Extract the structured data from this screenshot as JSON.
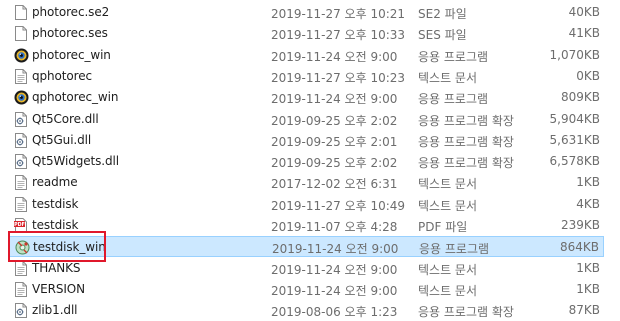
{
  "files": [
    {
      "name": "photorec.se2",
      "date": "2019-11-27 오후 10:21",
      "type": "SE2 파일",
      "size": "40KB",
      "icon": "file-icon"
    },
    {
      "name": "photorec.ses",
      "date": "2019-11-27 오후 10:33",
      "type": "SES 파일",
      "size": "41KB",
      "icon": "file-icon"
    },
    {
      "name": "photorec_win",
      "date": "2019-11-24 오전 9:00",
      "type": "응용 프로그램",
      "size": "1,070KB",
      "icon": "photorec-app-icon"
    },
    {
      "name": "qphotorec",
      "date": "2019-11-27 오후 10:23",
      "type": "텍스트 문서",
      "size": "0KB",
      "icon": "text-file-icon"
    },
    {
      "name": "qphotorec_win",
      "date": "2019-11-24 오전 9:00",
      "type": "응용 프로그램",
      "size": "809KB",
      "icon": "photorec-app-icon"
    },
    {
      "name": "Qt5Core.dll",
      "date": "2019-09-25 오후 2:02",
      "type": "응용 프로그램 확장",
      "size": "5,904KB",
      "icon": "dll-file-icon"
    },
    {
      "name": "Qt5Gui.dll",
      "date": "2019-09-25 오후 2:01",
      "type": "응용 프로그램 확장",
      "size": "5,631KB",
      "icon": "dll-file-icon"
    },
    {
      "name": "Qt5Widgets.dll",
      "date": "2019-09-25 오후 2:02",
      "type": "응용 프로그램 확장",
      "size": "6,578KB",
      "icon": "dll-file-icon"
    },
    {
      "name": "readme",
      "date": "2017-12-02 오전 6:31",
      "type": "텍스트 문서",
      "size": "1KB",
      "icon": "text-file-icon"
    },
    {
      "name": "testdisk",
      "date": "2019-11-27 오후 10:49",
      "type": "텍스트 문서",
      "size": "4KB",
      "icon": "text-file-icon"
    },
    {
      "name": "testdisk",
      "date": "2019-11-07 오후 4:28",
      "type": "PDF 파일",
      "size": "239KB",
      "icon": "pdf-file-icon",
      "icon_label": "PDF"
    },
    {
      "name": "testdisk_win",
      "date": "2019-11-24 오전 9:00",
      "type": "응용 프로그램",
      "size": "864KB",
      "icon": "testdisk-app-icon",
      "selected": true
    },
    {
      "name": "THANKS",
      "date": "2019-11-24 오전 9:00",
      "type": "텍스트 문서",
      "size": "1KB",
      "icon": "text-file-icon"
    },
    {
      "name": "VERSION",
      "date": "2019-11-24 오전 9:00",
      "type": "텍스트 문서",
      "size": "1KB",
      "icon": "text-file-icon"
    },
    {
      "name": "zlib1.dll",
      "date": "2019-08-06 오후 1:23",
      "type": "응용 프로그램 확장",
      "size": "87KB",
      "icon": "dll-file-icon"
    }
  ],
  "colors": {
    "selection_bg": "#cce8ff",
    "selection_border": "#99d1ff",
    "highlight_box": "#e0182b",
    "pdf_red": "#d9242b"
  }
}
